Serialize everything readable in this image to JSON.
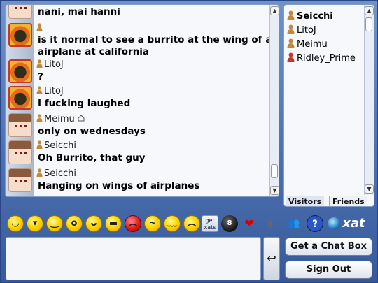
{
  "messages": [
    {
      "avatar": "anime-girl-avatar",
      "nick": "",
      "text": "nani, mai hanni"
    },
    {
      "avatar": "bomb-avatar",
      "nick": "",
      "text": "is it normal to see a burrito at the wing of an"
    },
    {
      "avatar": "",
      "nick": "",
      "text": "airplane at california"
    },
    {
      "avatar": "bomb-avatar",
      "nick": "LitoJ",
      "text": "?"
    },
    {
      "avatar": "bomb-avatar",
      "nick": "LitoJ",
      "text": "I fucking laughed"
    },
    {
      "avatar": "anime-girl-avatar",
      "nick": "Meimu",
      "text": "only on wednesdays"
    },
    {
      "avatar": "anime-girl-avatar",
      "nick": "Seicchi",
      "text": "Oh Burrito, that guy"
    },
    {
      "avatar": "anime-girl-avatar",
      "nick": "Seicchi",
      "text": "Hanging on wings of airplanes"
    }
  ],
  "users": [
    {
      "name": "Seicchi",
      "bold": true
    },
    {
      "name": "LitoJ",
      "bold": false
    },
    {
      "name": "Meimu",
      "bold": false
    },
    {
      "name": "Ridley_Prime",
      "bold": false
    }
  ],
  "tabs": {
    "visitors": "Visitors",
    "friends": "Friends"
  },
  "toolbar": {
    "getxats_line1": "get",
    "getxats_line2": "xats",
    "xat_logo": "xat"
  },
  "buttons": {
    "get_chat_box": "Get a Chat Box",
    "sign_out": "Sign Out",
    "send": "↩"
  },
  "colors": {
    "frame": "#4f74b3",
    "panel": "#f6f8fb",
    "member_person": "#c08a3e",
    "owner_person": "#c0392b"
  }
}
